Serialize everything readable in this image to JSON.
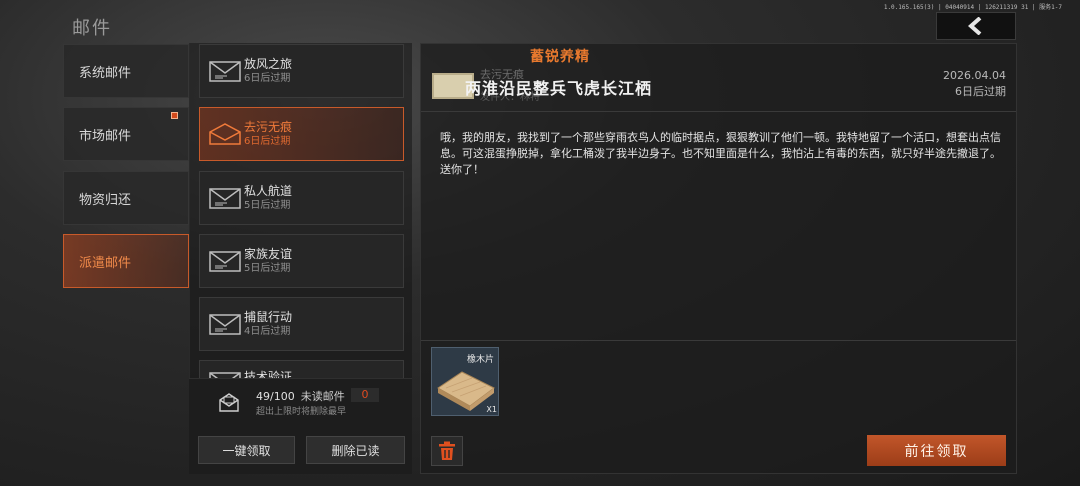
{
  "header": {
    "title": "邮件",
    "version": "1.0.165.165(3) | 04040914 | 126211319 31 | 服务1-7"
  },
  "categories": [
    {
      "label": "系统邮件"
    },
    {
      "label": "市场邮件"
    },
    {
      "label": "物资归还"
    },
    {
      "label": "派遣邮件"
    }
  ],
  "mails": [
    {
      "name": "放风之旅",
      "expire": "6日后过期"
    },
    {
      "name": "去污无痕",
      "expire": "6日后过期"
    },
    {
      "name": "私人航道",
      "expire": "5日后过期"
    },
    {
      "name": "家族友谊",
      "expire": "5日后过期"
    },
    {
      "name": "捕鼠行动",
      "expire": "4日后过期"
    },
    {
      "name": "技术验证",
      "expire": ""
    }
  ],
  "footer": {
    "count": "49/100",
    "unread_label": "未读邮件",
    "unread_count": "0",
    "hint": "超出上限时将删除最早",
    "claim_all": "一键领取",
    "delete_read": "删除已读"
  },
  "detail": {
    "sender_banner": "蓄锐养精",
    "ghost_title": "去污无痕",
    "ghost_sender": "发件人：林特",
    "subject": "两淮沿民整兵飞虎长江栖",
    "date": "2026.04.04",
    "expire": "6日后过期",
    "body": "哦，我的朋友，我找到了一个那些穿雨衣鸟人的临时据点，狠狠教训了他们一顿。我特地留了一个活口，想套出点信息。可这混蛋挣脱掉，拿化工桶泼了我半边身子。也不知里面是什么，我怕沾上有毒的东西，就只好半途先撤退了。送你了！",
    "item": {
      "name": "橡木片",
      "qty": "X1"
    },
    "claim": "前往领取"
  },
  "colors": {
    "accent": "#c85a2a",
    "accent_text": "#f07a3a",
    "claim_bg": "#b24a22"
  }
}
